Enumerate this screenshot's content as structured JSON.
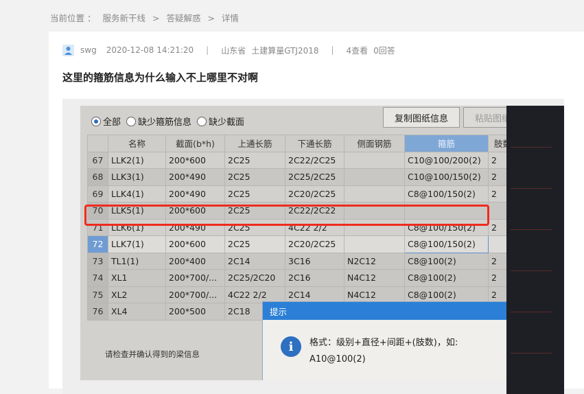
{
  "breadcrumb": {
    "label": "当前位置 ：",
    "items": [
      "服务新干线",
      "答疑解惑",
      "详情"
    ],
    "sep": ">"
  },
  "post": {
    "author": "swg",
    "datetime": "2020-12-08 14:21:20",
    "location": "山东省",
    "software": "土建算量GTJ2018",
    "views": "4查看",
    "answers": "0回答",
    "separator": "|",
    "title": "这里的箍筋信息为什么输入不上哪里不对啊"
  },
  "photo": {
    "radios": [
      {
        "label": "全部",
        "checked": true
      },
      {
        "label": "缺少箍筋信息",
        "checked": false
      },
      {
        "label": "缺少截面",
        "checked": false
      }
    ],
    "copy_button": "复制图纸信息",
    "paste_button": "粘贴图纸信息",
    "columns": [
      "",
      "名称",
      "截面(b*h)",
      "上通长筋",
      "下通长筋",
      "侧面钢筋",
      "箍筋",
      "肢数"
    ],
    "rows": [
      [
        "67",
        "LLK2(1)",
        "200*600",
        "2C25",
        "2C22/2C25",
        "",
        "C10@100/200(2)",
        "2"
      ],
      [
        "68",
        "LLK3(1)",
        "200*490",
        "2C25",
        "2C25/2C25",
        "",
        "C10@100/150(2)",
        "2"
      ],
      [
        "69",
        "LLK4(1)",
        "200*490",
        "2C25",
        "2C20/2C25",
        "",
        "C8@100/150(2)",
        "2"
      ],
      [
        "70",
        "LLK5(1)",
        "200*600",
        "2C25",
        "2C22/2C22",
        "",
        "",
        ""
      ],
      [
        "71",
        "LLK6(1)",
        "200*490",
        "2C25",
        "4C22 2/2",
        "",
        "C8@100/150(2)",
        "2"
      ],
      [
        "72",
        "LLK7(1)",
        "200*600",
        "2C25",
        "2C20/2C25",
        "",
        "C8@100/150(2)",
        ""
      ],
      [
        "73",
        "TL1(1)",
        "200*400",
        "2C14",
        "3C16",
        "N2C12",
        "C8@100(2)",
        "2"
      ],
      [
        "74",
        "XL1",
        "200*700/...",
        "2C25/2C20",
        "2C16",
        "N4C12",
        "C8@100(2)",
        "2"
      ],
      [
        "75",
        "XL2",
        "200*700/...",
        "4C22 2/2",
        "2C14",
        "N4C12",
        "C8@100(2)",
        "2"
      ],
      [
        "76",
        "XL4",
        "200*500",
        "2C18",
        "",
        "",
        "",
        ""
      ]
    ],
    "hint": "请检查并确认得到的梁信息",
    "dialog": {
      "title": "提示",
      "close": "×",
      "icon": "i",
      "line1": "格式：级别+直径+间距+(肢数)，如:",
      "line2": "A10@100(2)"
    }
  }
}
